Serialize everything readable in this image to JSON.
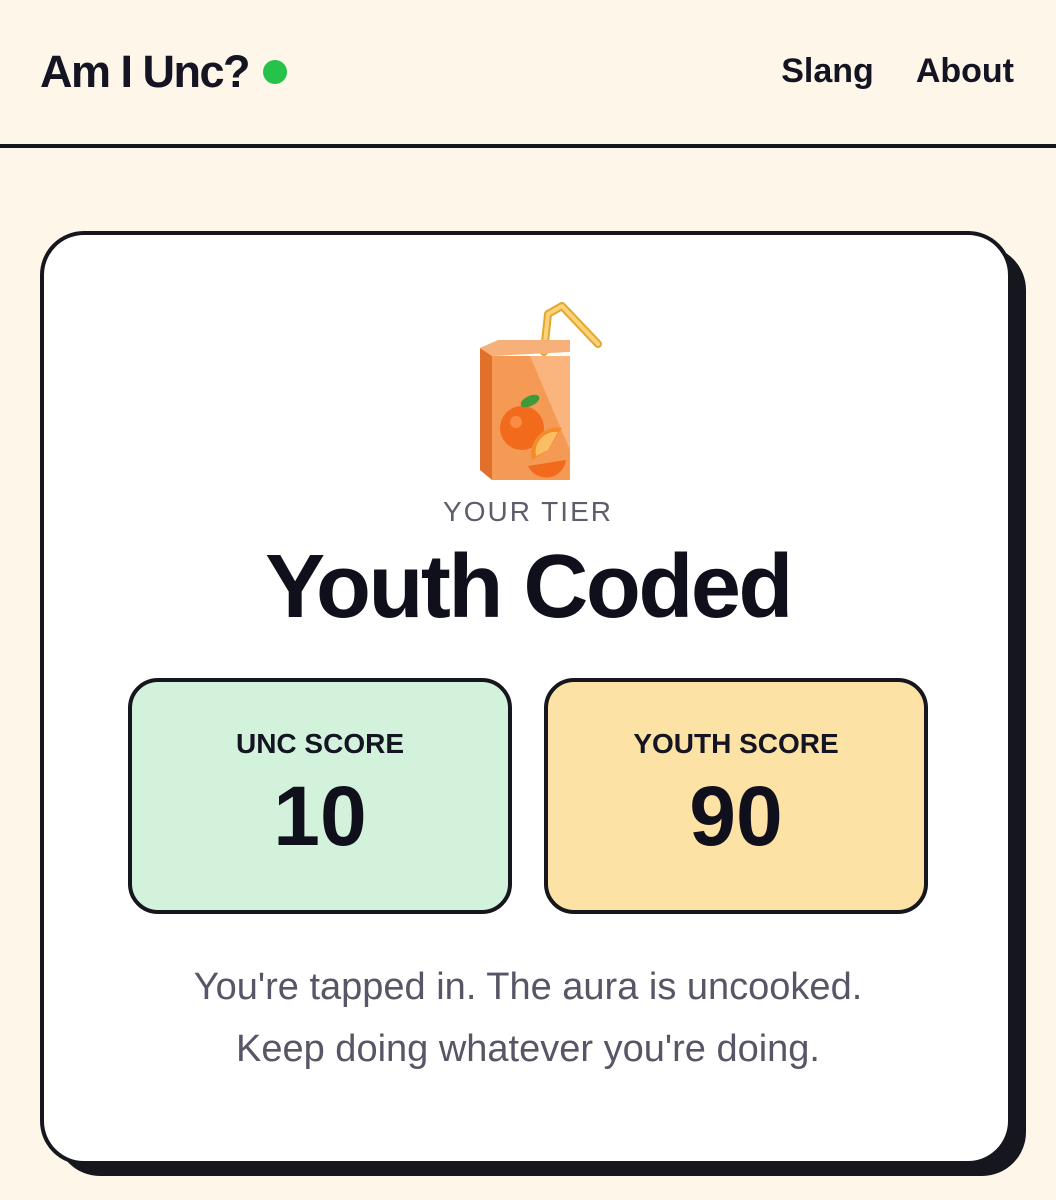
{
  "header": {
    "brand": "Am I Unc?",
    "nav": [
      "Slang",
      "About"
    ]
  },
  "result": {
    "icon": "juice-box-icon",
    "tier_label": "YOUR TIER",
    "tier_name": "Youth Coded",
    "scores": [
      {
        "label": "UNC SCORE",
        "value": "10",
        "color": "#d2f2dc"
      },
      {
        "label": "YOUTH SCORE",
        "value": "90",
        "color": "#fde2a6"
      }
    ],
    "message_lines": [
      "You're tapped in. The aura is uncooked.",
      "Keep doing whatever you're doing."
    ]
  },
  "colors": {
    "background": "#fdf6e9",
    "status_dot": "#27c24a",
    "ink": "#16161f"
  }
}
